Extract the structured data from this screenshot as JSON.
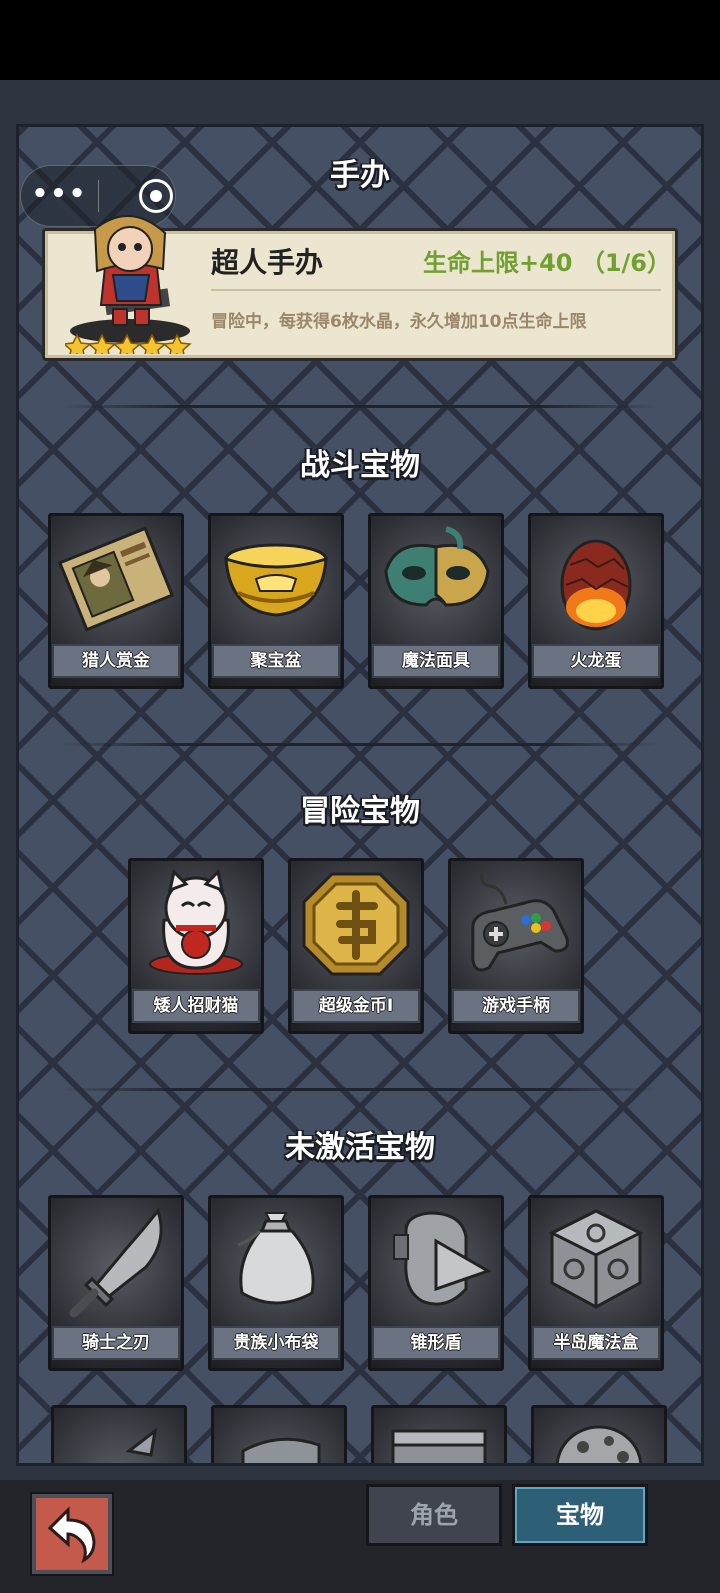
{
  "header": {
    "title": "手办"
  },
  "capsule": {
    "more_label": "•••"
  },
  "figure_card": {
    "name": "超人手办",
    "bonus": "生命上限+40 （1/6）",
    "description": "冒险中，每获得6枚水晶，永久增加10点生命上限",
    "stars": 5
  },
  "sections": {
    "combat": {
      "title": "战斗宝物",
      "items": [
        {
          "label": "猎人赏金",
          "icon": "bounty-poster-icon"
        },
        {
          "label": "聚宝盆",
          "icon": "treasure-bowl-icon"
        },
        {
          "label": "魔法面具",
          "icon": "magic-mask-icon"
        },
        {
          "label": "火龙蛋",
          "icon": "dragon-egg-icon"
        }
      ]
    },
    "adventure": {
      "title": "冒险宝物",
      "items": [
        {
          "label": "矮人招财猫",
          "icon": "lucky-cat-icon"
        },
        {
          "label": "超级金币I",
          "icon": "gold-coin-icon"
        },
        {
          "label": "游戏手柄",
          "icon": "gamepad-icon"
        }
      ]
    },
    "inactive": {
      "title": "未激活宝物",
      "items": [
        {
          "label": "骑士之刃",
          "icon": "knight-blade-icon"
        },
        {
          "label": "贵族小布袋",
          "icon": "cloth-bag-icon"
        },
        {
          "label": "锥形盾",
          "icon": "cone-shield-icon"
        },
        {
          "label": "半岛魔法盒",
          "icon": "magic-cube-icon"
        }
      ]
    }
  },
  "bottom_tabs": [
    {
      "label": "角色",
      "active": false
    },
    {
      "label": "宝物",
      "active": true
    }
  ],
  "colors": {
    "accent": "#2d5f76",
    "bonus": "#6fa030",
    "card_bg": "#ece5cf"
  }
}
